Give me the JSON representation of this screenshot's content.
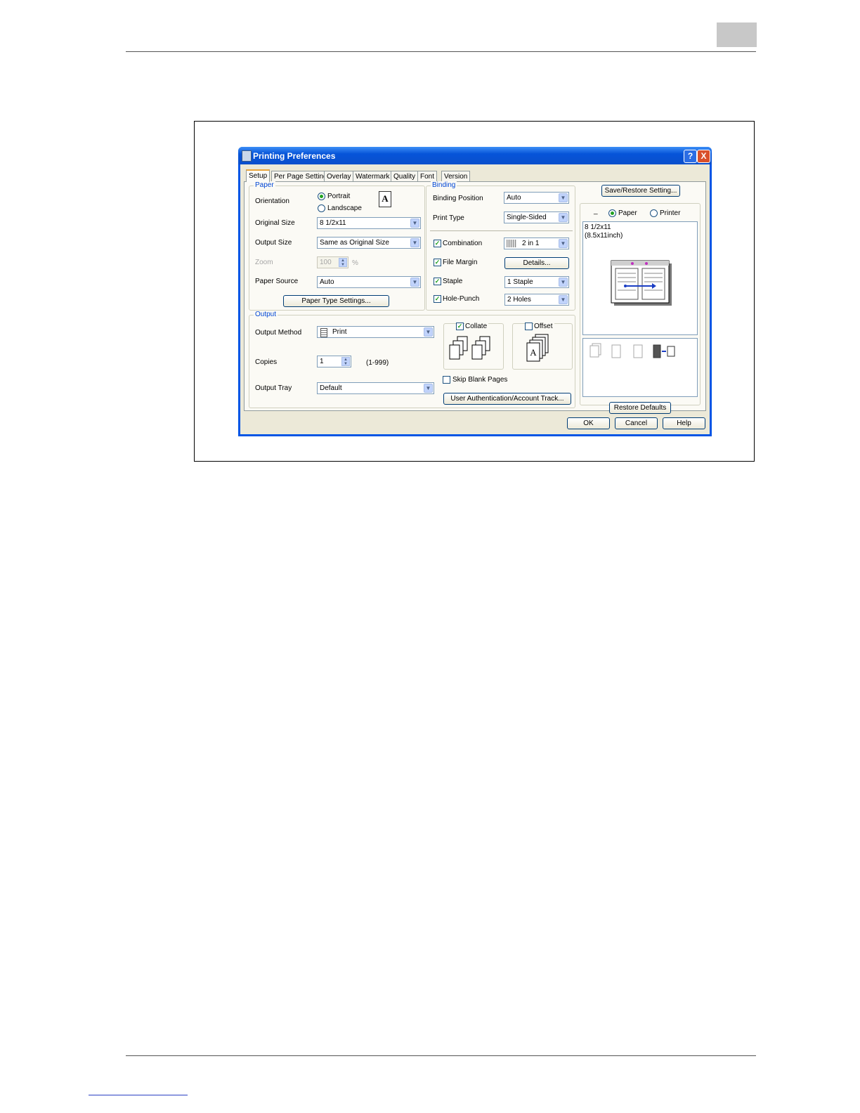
{
  "dialog": {
    "title": "Printing Preferences",
    "help_button": "?",
    "close_button": "X"
  },
  "tabs": [
    "Setup",
    "Per Page Setting",
    "Overlay",
    "Watermark",
    "Quality",
    "Font",
    "Version"
  ],
  "paper": {
    "group_title": "Paper",
    "orientation_label": "Orientation",
    "portrait_label": "Portrait",
    "landscape_label": "Landscape",
    "orientation_selected": "Portrait",
    "orientation_glyph": "A",
    "original_size_label": "Original Size",
    "original_size_value": "8 1/2x11",
    "output_size_label": "Output Size",
    "output_size_value": "Same as Original Size",
    "zoom_label": "Zoom",
    "zoom_value": "100",
    "zoom_unit": "%",
    "paper_source_label": "Paper Source",
    "paper_source_value": "Auto",
    "paper_type_button": "Paper Type Settings..."
  },
  "binding": {
    "group_title": "Binding",
    "binding_position_label": "Binding Position",
    "binding_position_value": "Auto",
    "print_type_label": "Print Type",
    "print_type_value": "Single-Sided",
    "combination_label": "Combination",
    "combination_checked": true,
    "combination_value": "2 in 1",
    "file_margin_label": "File Margin",
    "file_margin_checked": true,
    "details_button": "Details...",
    "staple_label": "Staple",
    "staple_checked": true,
    "staple_value": "1 Staple",
    "hole_punch_label": "Hole-Punch",
    "hole_punch_checked": true,
    "hole_punch_value": "2 Holes"
  },
  "output": {
    "group_title": "Output",
    "output_method_label": "Output Method",
    "output_method_value": "Print",
    "copies_label": "Copies",
    "copies_value": "1",
    "copies_range": "(1-999)",
    "output_tray_label": "Output Tray",
    "output_tray_value": "Default",
    "collate_label": "Collate",
    "collate_checked": true,
    "offset_label": "Offset",
    "offset_checked": false,
    "offset_glyph": "A",
    "skip_blank_label": "Skip Blank Pages",
    "skip_blank_checked": false,
    "user_auth_button": "User Authentication/Account Track..."
  },
  "right_panel": {
    "save_restore_button": "Save/Restore Setting...",
    "view_paper_label": "Paper",
    "view_printer_label": "Printer",
    "view_selected": "Paper",
    "preview_size_line1": "8 1/2x11",
    "preview_size_line2": "(8.5x11inch)",
    "restore_defaults_button": "Restore Defaults"
  },
  "footer_buttons": {
    "ok": "OK",
    "cancel": "Cancel",
    "help": "Help"
  },
  "colors": {
    "titlebar": "#0a4fcc",
    "dialog_face": "#ece9d8",
    "group_title": "#0046d5",
    "active_tab_accent": "#e8a43a"
  }
}
